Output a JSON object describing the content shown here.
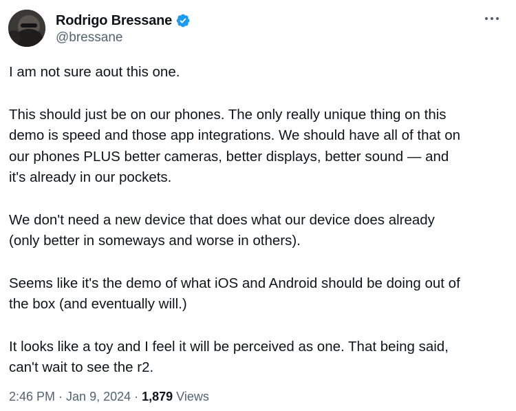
{
  "author": {
    "display_name": "Rodrigo Bressane",
    "handle": "@bressane",
    "verified_icon": "verified-badge-icon",
    "verified_color": "#1d9bf0"
  },
  "menu_icon": "more-horizontal-icon",
  "tweet": {
    "paragraphs": [
      "I am not sure aout this one.",
      "This should just be on our phones. The only really unique thing on this\ndemo is speed and those app integrations. We should have all of that on\nour phones PLUS better cameras, better displays, better sound — and\nit's already in our pockets.",
      "We don't need a new device that does what our device does already\n(only better in someways and worse in others).",
      "Seems like it's the demo of what iOS and Android should be doing out of\nthe box (and eventually will.)",
      "It looks like a toy and I feel it will be perceived as one. That being said,\ncan't wait to see the r2."
    ]
  },
  "meta": {
    "time": "2:46 PM",
    "separator": " · ",
    "date": "Jan 9, 2024",
    "views_count": "1,879",
    "views_label": " Views"
  },
  "colors": {
    "text_primary": "#0f1419",
    "text_secondary": "#536471",
    "accent": "#1d9bf0"
  }
}
